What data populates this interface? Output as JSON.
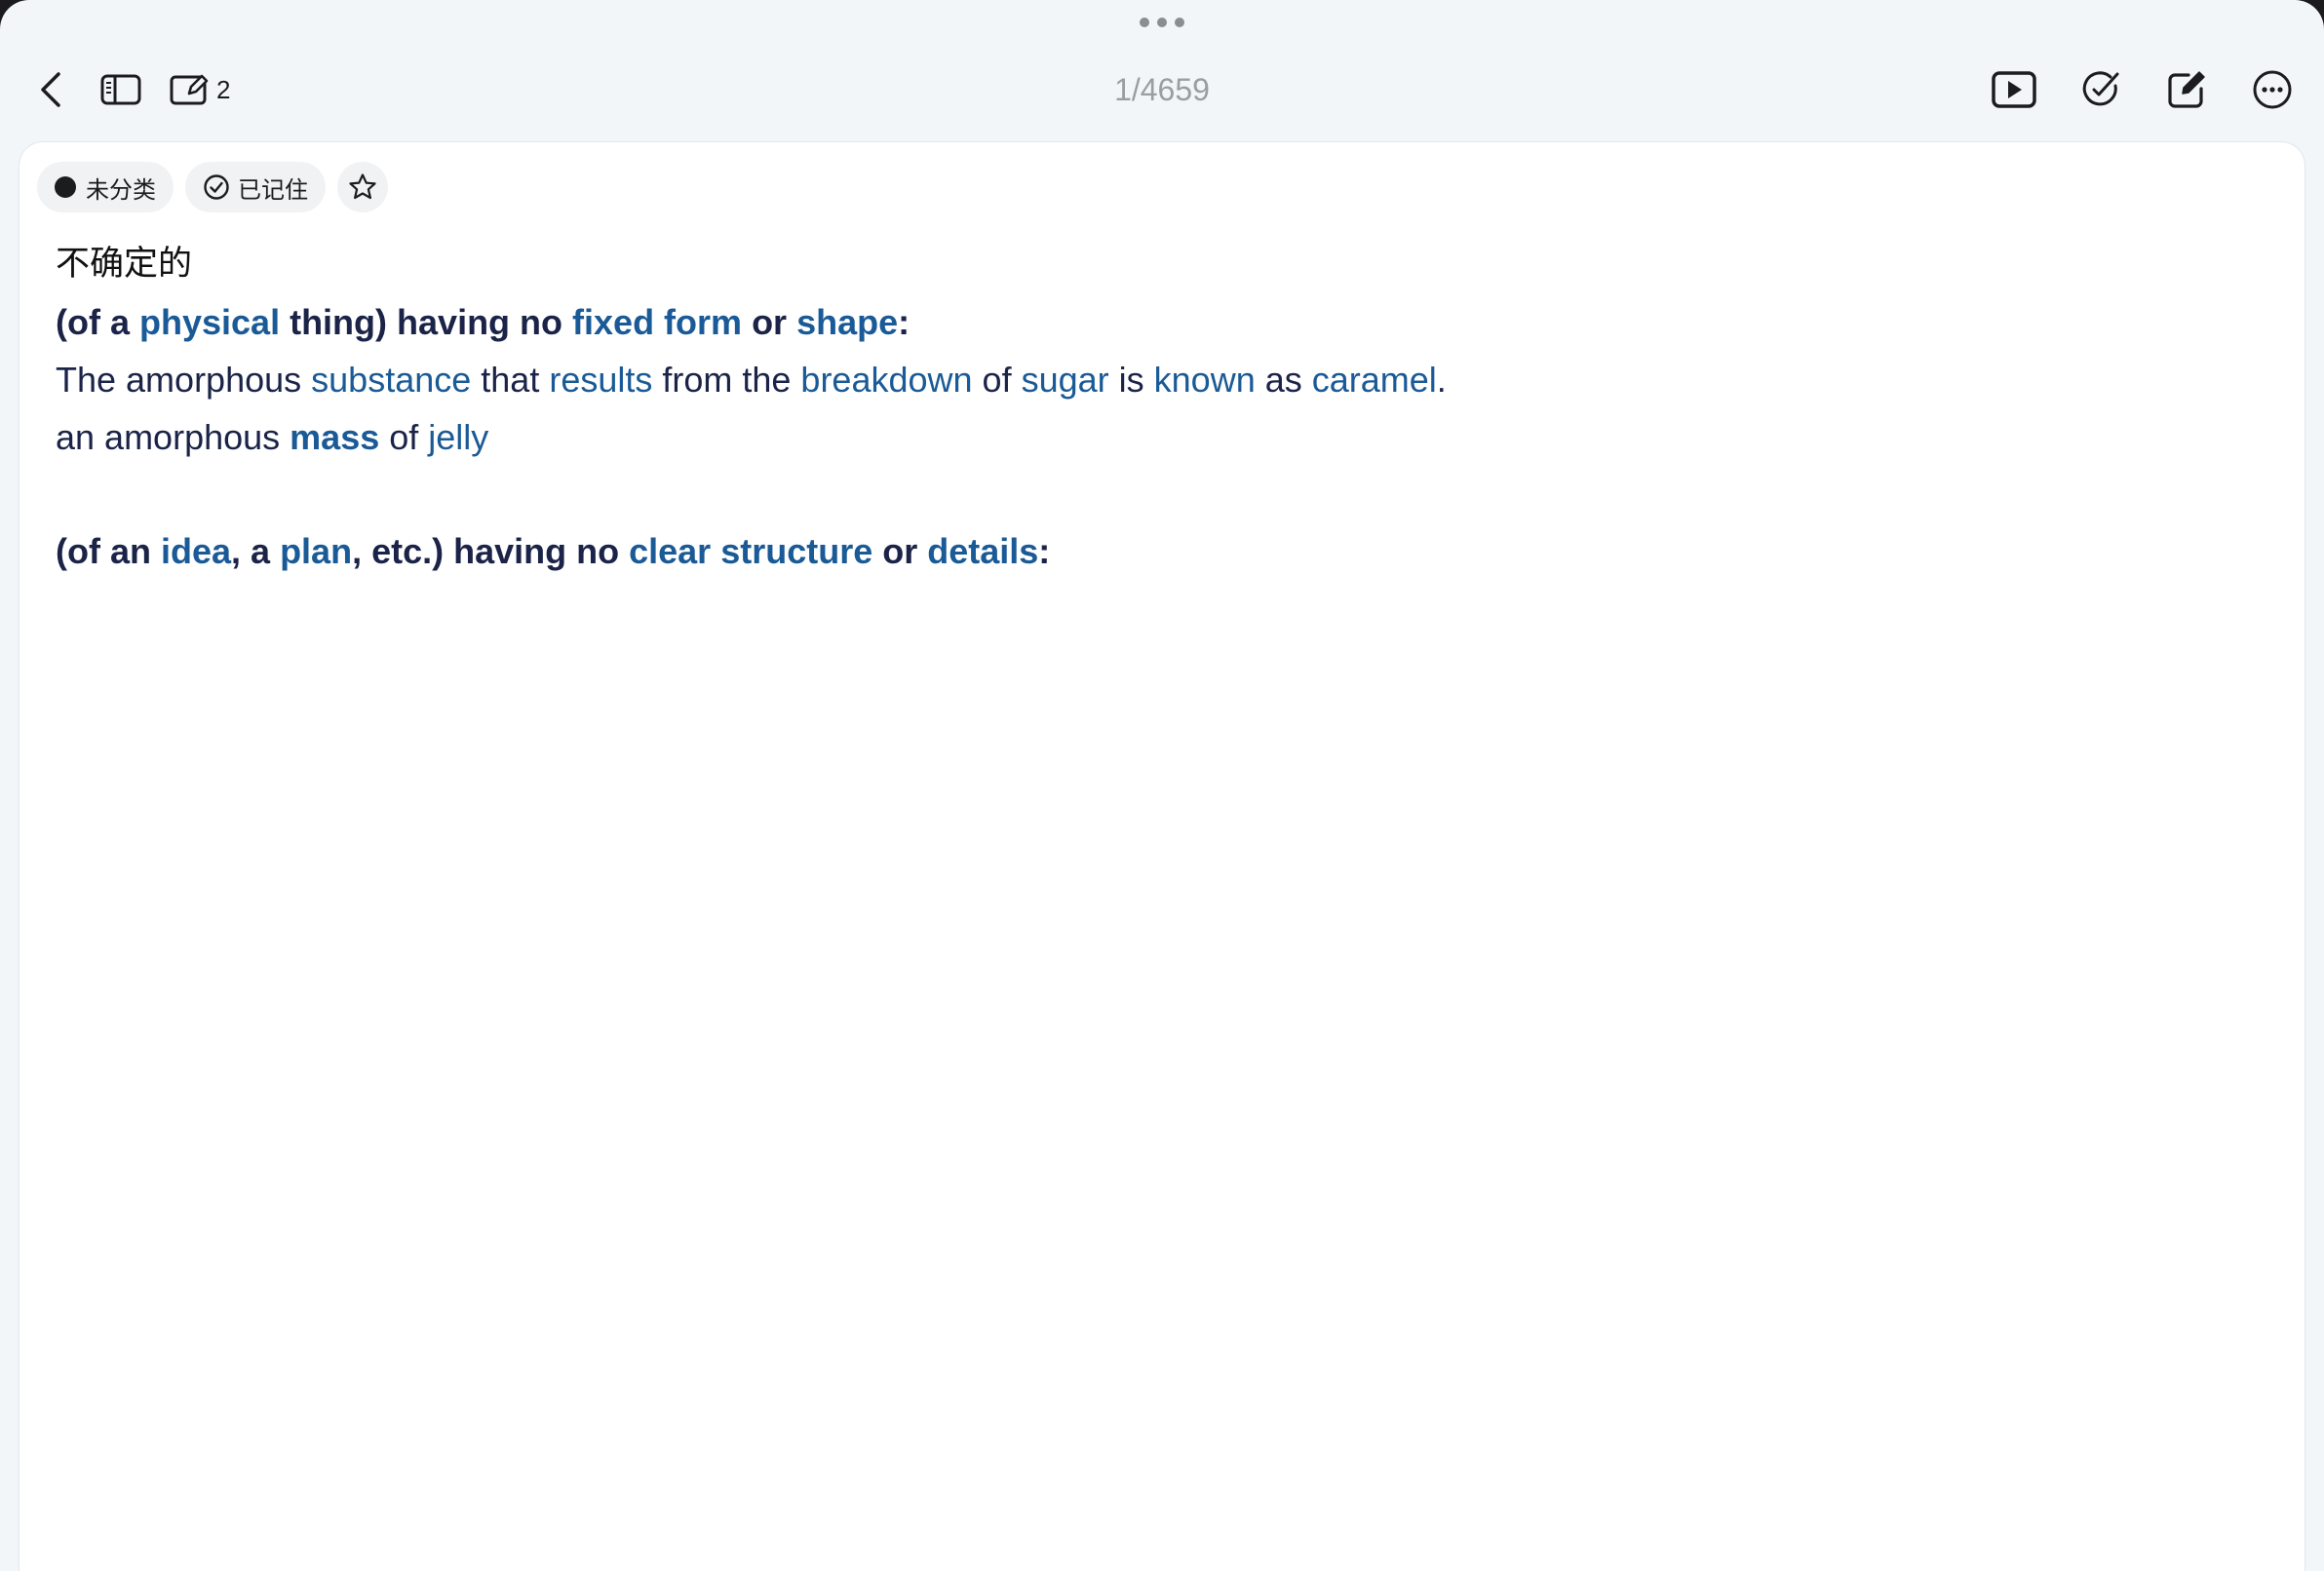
{
  "toolbar": {
    "edit_count": "2",
    "page_counter": "1/4659"
  },
  "tags": {
    "category": "未分类",
    "memorized": "已记住"
  },
  "card": {
    "translation": "不确定的",
    "def1": {
      "p1": "(of a ",
      "l1": "physical",
      "p2": " thing) having no ",
      "l2": "fixed form",
      "p3": " or ",
      "l3": "shape",
      "p4": ":"
    },
    "ex1": {
      "p1": "The amorphous ",
      "l1": "substance",
      "p2": " that ",
      "l2": "results",
      "p3": " from the ",
      "l3": "breakdown",
      "p4": " of ",
      "l4": "sugar",
      "p5": " is ",
      "l5": "known",
      "p6": " as ",
      "l6": "caramel",
      "p7": "."
    },
    "ex2": {
      "p1": "an amorphous ",
      "l1": "mass",
      "p2": " of ",
      "l2": "jelly"
    },
    "def2": {
      "p1": "(of an ",
      "l1": "idea",
      "p2": ", a ",
      "l2": "plan",
      "p3": ", etc.) having no ",
      "l3": "clear structure",
      "p4": " or ",
      "l4": "details",
      "p5": ":"
    }
  },
  "colors": {
    "link": "#1a5a96",
    "text": "#1b2448",
    "background": "#f3f6f9",
    "card": "#ffffff"
  },
  "icons": [
    "chevron-left-icon",
    "sidebar-icon",
    "edit-card-icon",
    "play-icon",
    "check-pen-icon",
    "compose-icon",
    "more-icon",
    "check-circle-icon",
    "star-icon"
  ]
}
